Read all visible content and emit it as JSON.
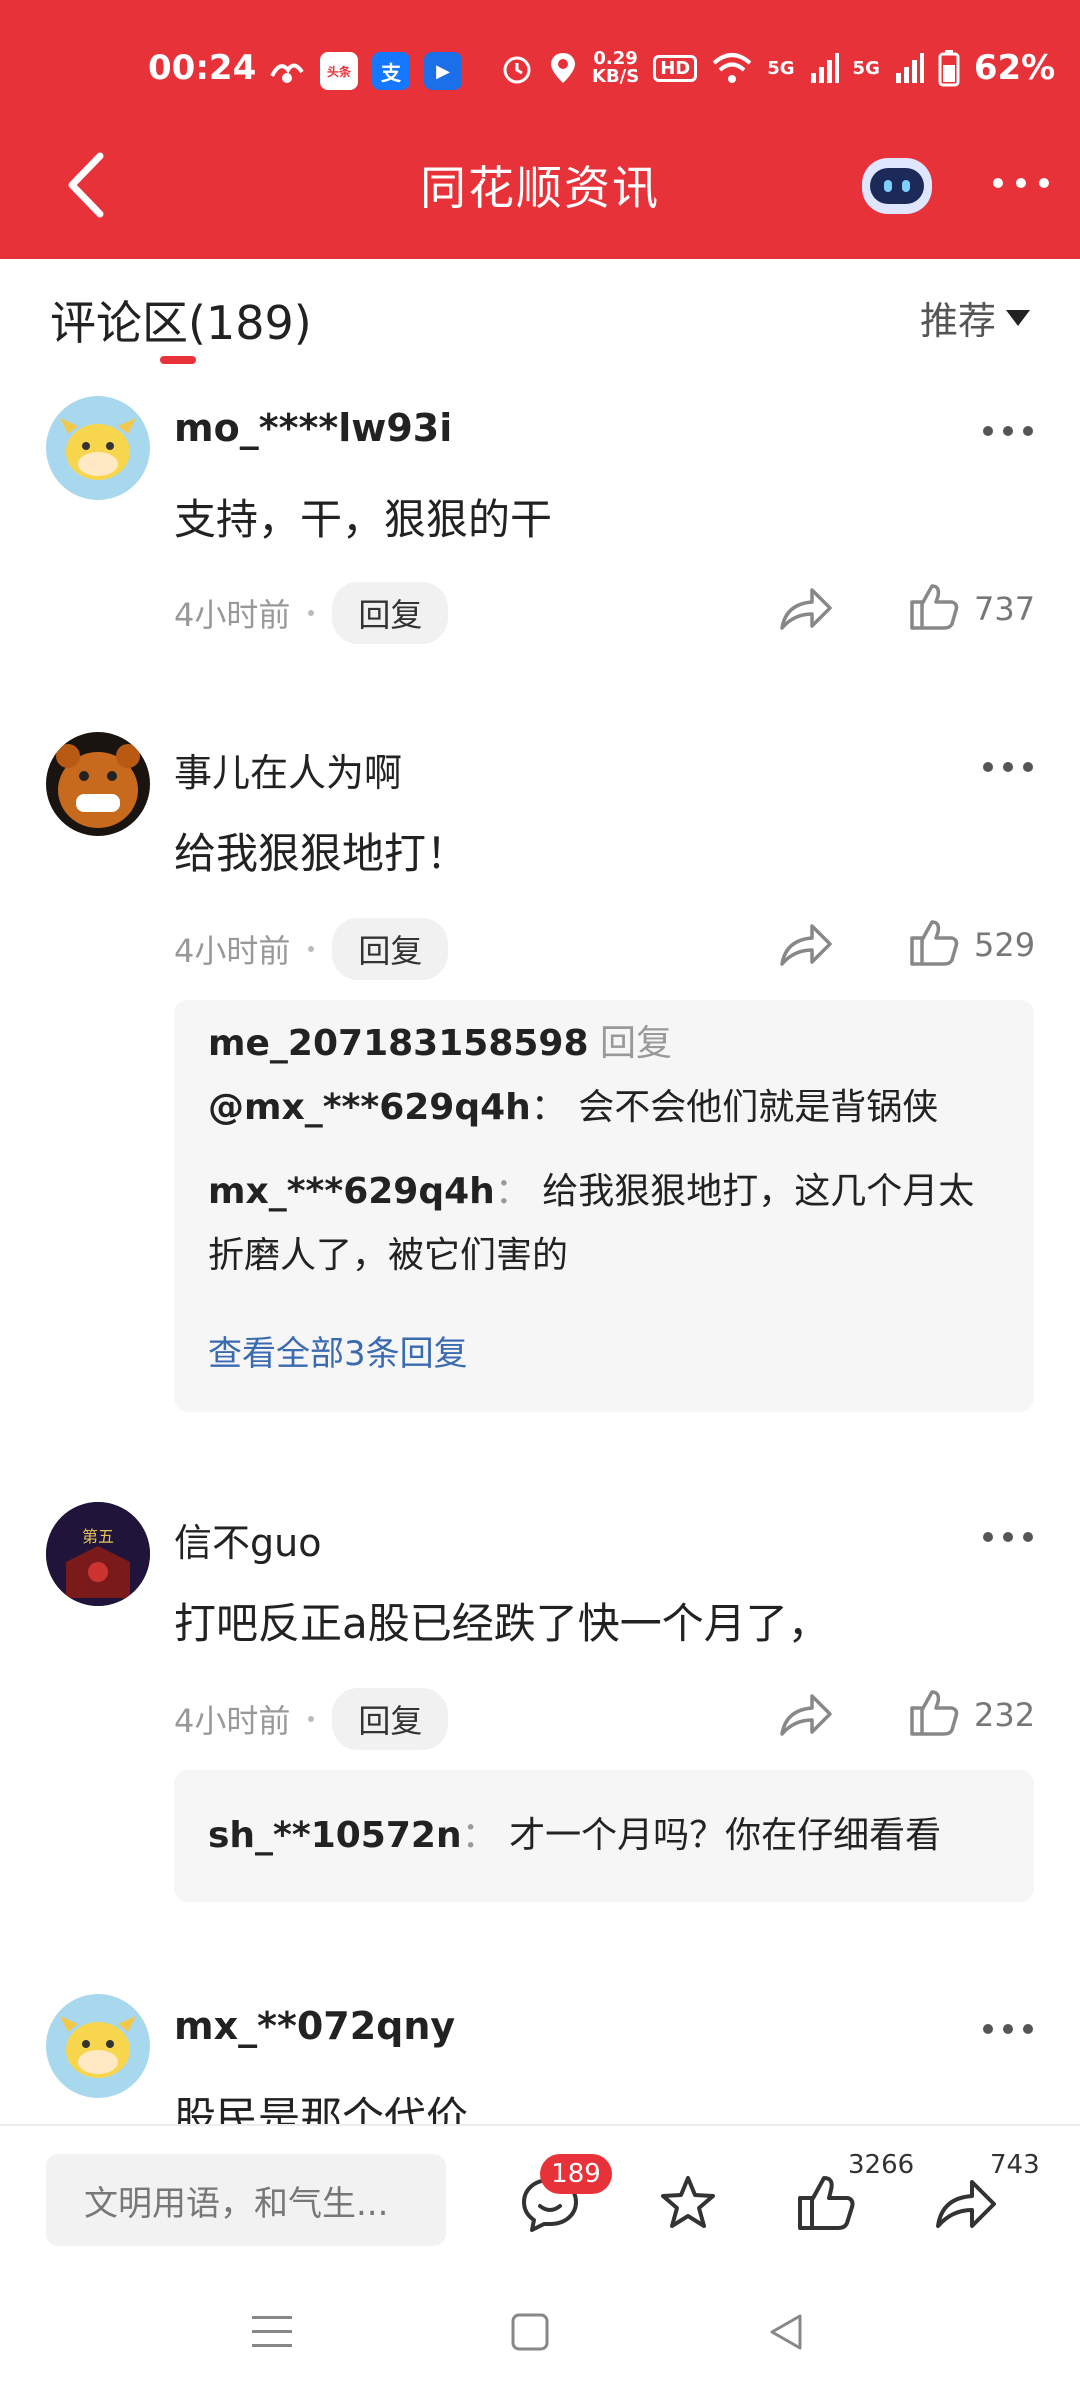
{
  "status_bar": {
    "time": "00:24",
    "app_icons": [
      "头条",
      "支",
      "▶"
    ],
    "net_speed": "0.29\nKB/S",
    "hd_label": "HD",
    "signal_1": "5G",
    "signal_2": "5G",
    "battery": "62%"
  },
  "header": {
    "title": "同花顺资讯"
  },
  "comments_header": {
    "title": "评论区(189)",
    "sort_label": "推荐"
  },
  "comments": [
    {
      "username": "mo_****lw93i",
      "content": "支持，干，狠狠的干",
      "time": "4小时前",
      "reply_label": "回复",
      "likes": "737"
    },
    {
      "username": "事儿在人为啊",
      "content": "给我狠狠地打！",
      "time": "4小时前",
      "reply_label": "回复",
      "likes": "529",
      "replies": [
        {
          "name": "me_207183158598",
          "reply_word": "回复",
          "target": "@mx_***629q4h",
          "sep": "：",
          "text": "会不会他们就是背锅侠"
        },
        {
          "name": "mx_***629q4h",
          "sep": "：",
          "text": "给我狠狠地打，这几个月太折磨人了，被它们害的"
        }
      ],
      "view_all": "查看全部3条回复"
    },
    {
      "username": "信不guo",
      "content": "打吧反正a股已经跌了快一个月了，",
      "time": "4小时前",
      "reply_label": "回复",
      "likes": "232",
      "replies": [
        {
          "name": "sh_**10572n",
          "sep": "：",
          "text": "才一个月吗？你在仔细看看"
        }
      ]
    },
    {
      "username": "mx_**072qny",
      "content": "股民是那个代价"
    }
  ],
  "bottom_bar": {
    "input_placeholder": "文明用语，和气生...",
    "comment_badge": "189",
    "like_count": "3266",
    "share_count": "743"
  },
  "colors": {
    "brand_red": "#e8323a",
    "link_blue": "#3a6bb0"
  },
  "icons": [
    "back-icon",
    "robot-icon",
    "more-icon",
    "share-icon",
    "like-icon",
    "comment-icon",
    "star-icon",
    "menu-icon",
    "home-icon",
    "back-nav-icon"
  ]
}
